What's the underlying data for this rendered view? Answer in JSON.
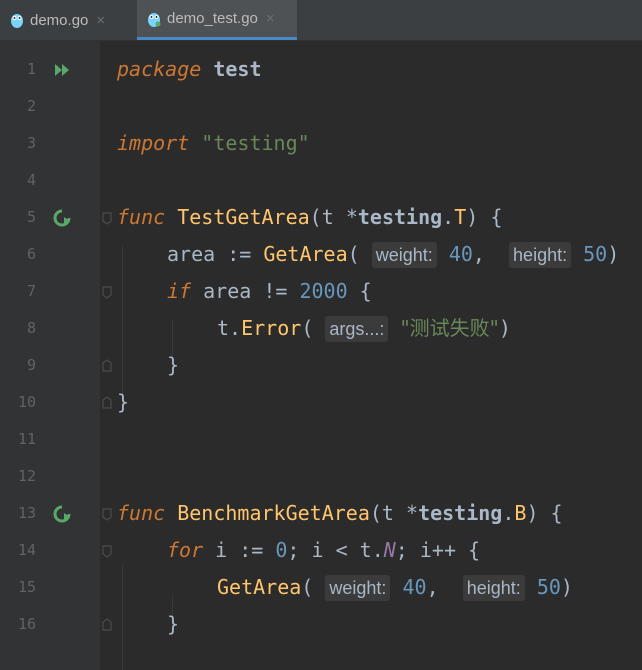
{
  "tabs": [
    {
      "label": "demo.go",
      "active": false
    },
    {
      "label": "demo_test.go",
      "active": true
    }
  ],
  "close_glyph": "×",
  "lines": [
    {
      "n": "1"
    },
    {
      "n": "2"
    },
    {
      "n": "3"
    },
    {
      "n": "4"
    },
    {
      "n": "5"
    },
    {
      "n": "6"
    },
    {
      "n": "7"
    },
    {
      "n": "8"
    },
    {
      "n": "9"
    },
    {
      "n": "10"
    },
    {
      "n": "11"
    },
    {
      "n": "12"
    },
    {
      "n": "13"
    },
    {
      "n": "14"
    },
    {
      "n": "15"
    },
    {
      "n": "16"
    }
  ],
  "code": {
    "l1": {
      "kw": "package",
      "name": "test"
    },
    "l3": {
      "kw": "import",
      "str": "\"testing\""
    },
    "l5": {
      "kw": "func",
      "fn": "TestGetArea",
      "open": "(",
      "param": "t ",
      "star": "*",
      "pkg": "testing",
      "dot": ".",
      "type": "T",
      "close": ") {"
    },
    "l6": {
      "var": "area := ",
      "fn": "GetArea",
      "open": "(",
      "hint1": "weight:",
      "num1": "40",
      "sep": ", ",
      "hint2": "height:",
      "num2": "50",
      "close": ")"
    },
    "l7": {
      "kw": "if",
      "rest": " area != ",
      "num": "2000",
      "brace": " {"
    },
    "l8": {
      "obj": "t.",
      "fn": "Error",
      "open": "(",
      "hint": "args...:",
      "str": "\"测试失败\"",
      "close": ")"
    },
    "l9": {
      "brace": "}"
    },
    "l10": {
      "brace": "}"
    },
    "l13": {
      "kw": "func",
      "fn": "BenchmarkGetArea",
      "open": "(",
      "param": "t ",
      "star": "*",
      "pkg": "testing",
      "dot": ".",
      "type": "B",
      "close": ") {"
    },
    "l14": {
      "kw": "for",
      "a": " i := ",
      "num": "0",
      "b": "; i < t.",
      "n": "N",
      "c": "; i++ {"
    },
    "l15": {
      "fn": "GetArea",
      "open": "(",
      "hint1": "weight:",
      "num1": "40",
      "sep": ", ",
      "hint2": "height:",
      "num2": "50",
      "close": ")"
    },
    "l16": {
      "brace": "}"
    }
  },
  "colors": {
    "background": "#2b2b2b",
    "gutter": "#313335",
    "keyword": "#cc7832",
    "function": "#ffc66d",
    "string": "#6a8759",
    "number": "#6897bb",
    "run_icon": "#59a869"
  }
}
